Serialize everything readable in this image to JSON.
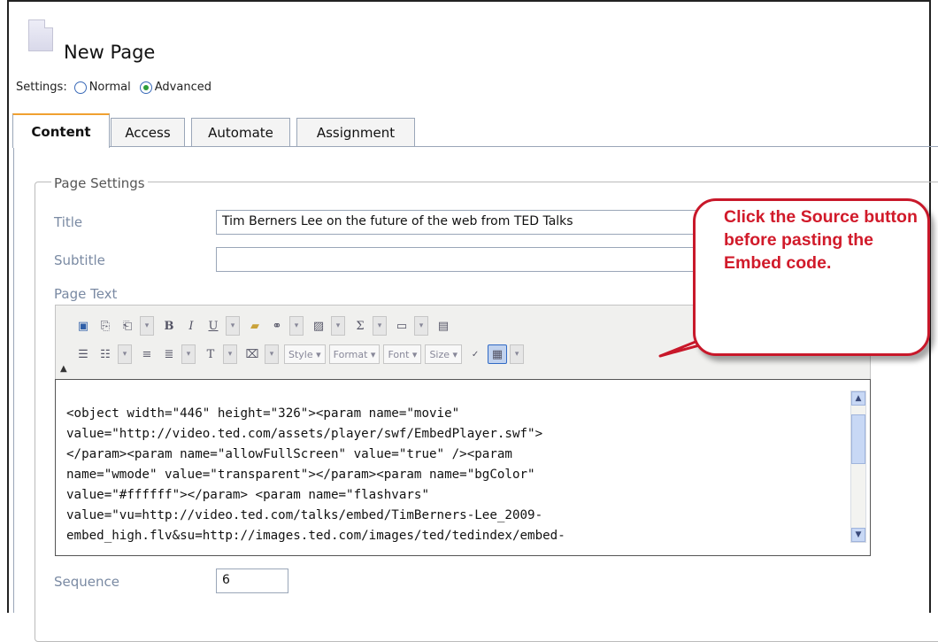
{
  "page": {
    "title": "New Page"
  },
  "settings": {
    "label": "Settings:",
    "options": [
      "Normal",
      "Advanced"
    ],
    "selected": "Advanced"
  },
  "tabs": [
    {
      "label": "Content",
      "active": true
    },
    {
      "label": "Access",
      "active": false
    },
    {
      "label": "Automate",
      "active": false
    },
    {
      "label": "Assignment",
      "active": false
    }
  ],
  "page_settings": {
    "legend": "Page Settings",
    "title_label": "Title",
    "title_value": "Tim Berners Lee on the future of the web from TED Talks",
    "subtitle_label": "Subtitle",
    "subtitle_value": "",
    "page_text_label": "Page Text",
    "sequence_label": "Sequence",
    "sequence_value": "6"
  },
  "toolbar": {
    "style_label": "Style",
    "format_label": "Format",
    "font_label": "Font",
    "size_label": "Size"
  },
  "editor": {
    "lines": [
      "<object width=\"446\" height=\"326\"><param name=\"movie\"",
      "value=\"http://video.ted.com/assets/player/swf/EmbedPlayer.swf\">",
      "</param><param name=\"allowFullScreen\" value=\"true\" /><param",
      "name=\"wmode\" value=\"transparent\"></param><param name=\"bgColor\"",
      "value=\"#ffffff\"></param> <param name=\"flashvars\"",
      "value=\"vu=http://video.ted.com/talks/embed/TimBerners-Lee_2009-",
      "embed_high.flv&su=http://images.ted.com/images/ted/tedindex/embed-"
    ]
  },
  "callout": {
    "text": "Click the Source button before pasting the Embed code.",
    "color": "#d11a2a"
  }
}
